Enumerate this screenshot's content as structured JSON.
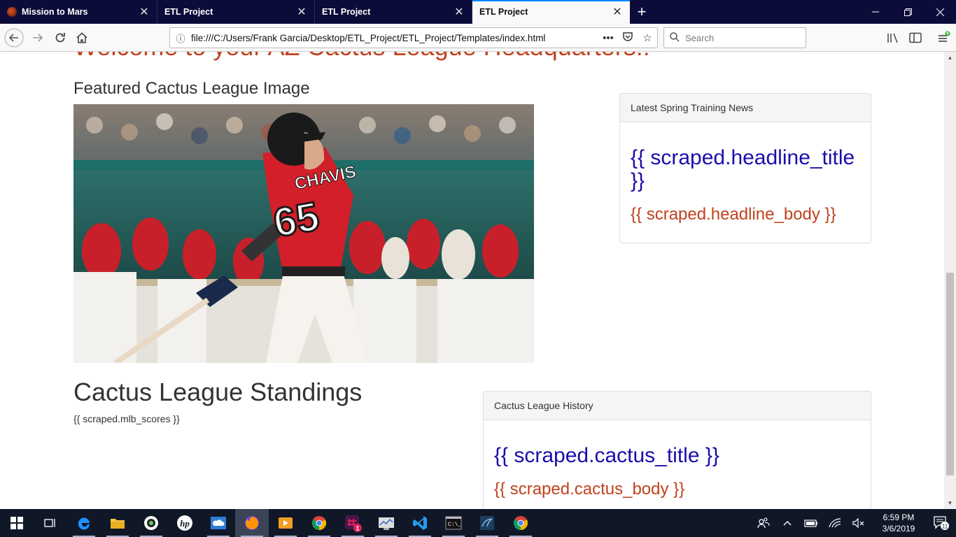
{
  "browser": {
    "tabs": [
      {
        "label": "Mission to Mars",
        "active": false
      },
      {
        "label": "ETL Project",
        "active": false
      },
      {
        "label": "ETL Project",
        "active": false
      },
      {
        "label": "ETL Project",
        "active": true
      }
    ],
    "new_tab_symbol": "+",
    "url": "file:///C:/Users/Frank Garcia/Desktop/ETL_Project/ETL_Project/Templates/index.html",
    "search_placeholder": "Search"
  },
  "page": {
    "welcome_heading": "Welcome to your AZ Cactus League Headquarters!!",
    "featured_title": "Featured Cactus League Image",
    "featured_image_jersey_name": "CHAVIS",
    "featured_image_jersey_number": "65",
    "news_panel": {
      "heading": "Latest Spring Training News",
      "title": "{{ scraped.headline_title }}",
      "body": "{{ scraped.headline_body }}"
    },
    "standings": {
      "title": "Cactus League Standings",
      "scores": "{{ scraped.mlb_scores }}"
    },
    "history_panel": {
      "heading": "Cactus League History",
      "title": "{{ scraped.cactus_title }}",
      "body": "{{ scraped.cactus_body }}"
    }
  },
  "taskbar": {
    "slack_badge": "1",
    "time": "6:59 PM",
    "date": "3/6/2019",
    "notification_count": "11"
  },
  "colors": {
    "tab_bg": "#0c0c3a",
    "accent_blue": "#0a84ff",
    "link_blue": "#1a0dab",
    "headline_orange": "#c0421e",
    "taskbar_bg": "#101828"
  }
}
